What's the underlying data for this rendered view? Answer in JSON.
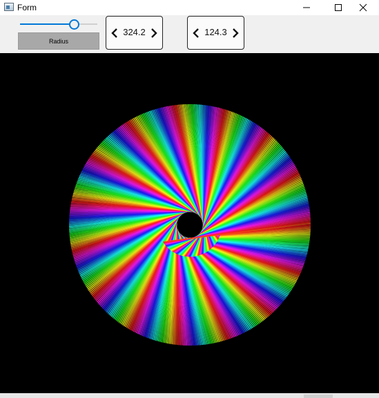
{
  "window": {
    "title": "Form"
  },
  "toolbar": {
    "radius_slider_value": 0.7,
    "radius_button_label": "Radius",
    "stepper1_value": "324.2",
    "stepper2_value": "124.3"
  },
  "canvas": {
    "background": "#000000",
    "accent": "#0078d7"
  },
  "icons": {
    "app": "form-app-icon",
    "minimize": "minimize-icon",
    "maximize": "maximize-icon",
    "close": "close-icon",
    "prev": "chevron-left-icon",
    "next": "chevron-right-icon"
  }
}
